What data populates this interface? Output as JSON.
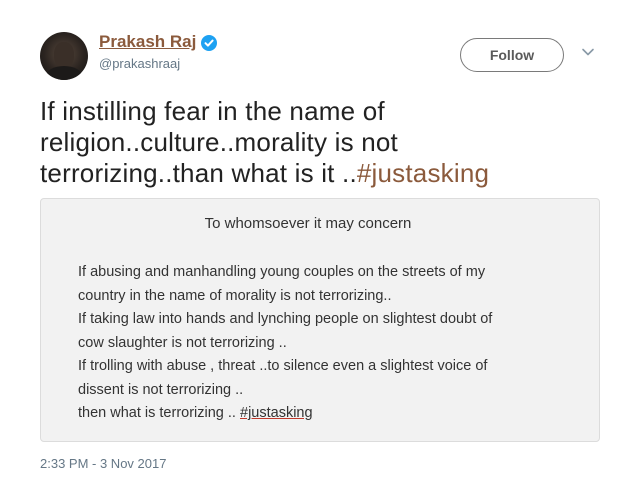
{
  "author": {
    "display_name": "Prakash Raj",
    "handle": "@prakashraaj",
    "verified": true
  },
  "follow_button": {
    "label": "Follow"
  },
  "tweet": {
    "lines": [
      "If instilling fear in the name of",
      "religion..culture..morality is not",
      "terrorizing..than what is it .."
    ],
    "hashtag": "#justasking"
  },
  "image_card": {
    "heading": "To whomsoever it may concern",
    "lines": [
      "If abusing and manhandling young couples on the streets of my",
      "country in the name of morality is not terrorizing..",
      "If taking law into hands and lynching people on slightest doubt of",
      "cow slaughter is not terrorizing ..",
      "If trolling with abuse , threat ..to silence even a slightest voice  of",
      "dissent is not terrorizing ..",
      "then what is terrorizing .. "
    ],
    "closing_hashtag": "#justasking"
  },
  "timestamp": "2:33 PM - 3 Nov 2017",
  "colors": {
    "name": "#8b5a3c",
    "verified": "#1da1f2",
    "hashtag": "#8b5a3c",
    "meta": "#657786",
    "card_bg": "#f2f2f2"
  },
  "icons": [
    "avatar",
    "verified-badge-icon",
    "chevron-down-icon"
  ]
}
